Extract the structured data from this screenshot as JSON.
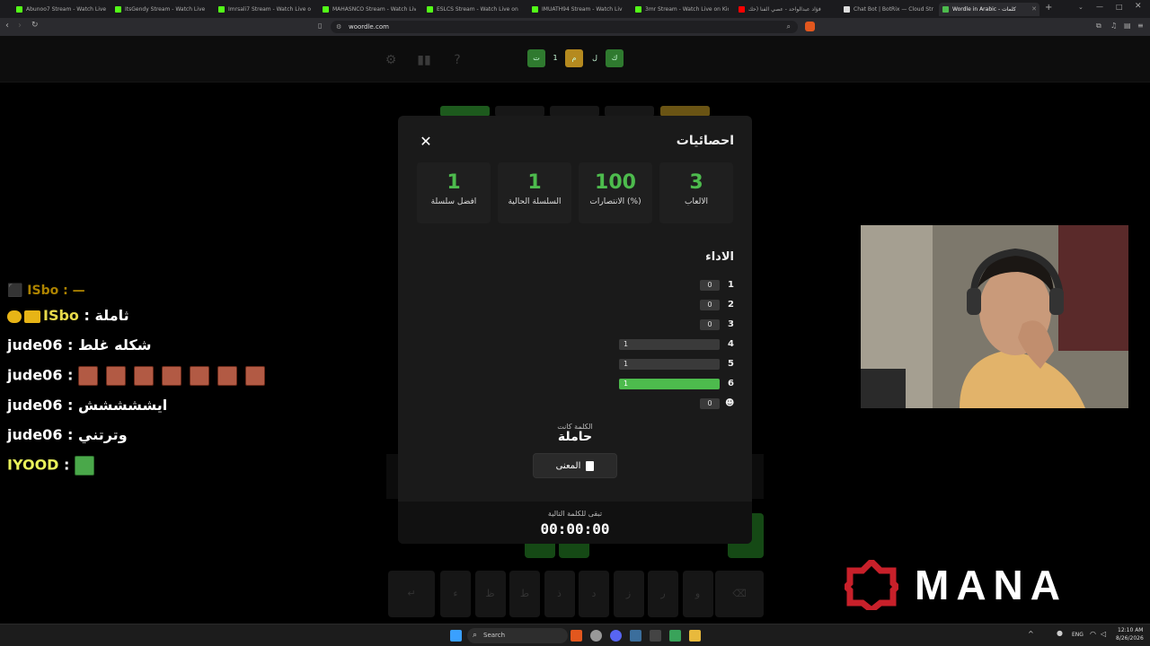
{
  "browser": {
    "tabs": [
      {
        "label": "Abunoo7 Stream - Watch Live",
        "favicon": "kick-icon"
      },
      {
        "label": "ItsGendy Stream - Watch Live",
        "favicon": "kick-icon"
      },
      {
        "label": "Imrsali7 Stream - Watch Live o",
        "favicon": "kick-icon"
      },
      {
        "label": "MAHASNCO Stream - Watch Live",
        "favicon": "kick-icon"
      },
      {
        "label": "ESLCS Stream - Watch Live on",
        "favicon": "kick-icon"
      },
      {
        "label": "IMUATH94 Stream - Watch Liv",
        "favicon": "kick-icon"
      },
      {
        "label": "3mr Stream - Watch Live on Kick",
        "favicon": "kick-icon"
      },
      {
        "label": "فؤاد عبدالواحد - عصي الفنا (حك",
        "favicon": "youtube-icon"
      },
      {
        "label": "Chat Bot | BotRix — Cloud Stream",
        "favicon": "botrix-icon"
      },
      {
        "label": "Wordle in Arabic - كلمات",
        "favicon": "woordle-icon",
        "active": true
      }
    ],
    "url": "woordle.com"
  },
  "game_header": {
    "tiles": [
      {
        "letter": "ت",
        "color": "#2f7a2f"
      },
      {
        "letter": "1",
        "color": "transparent"
      },
      {
        "letter": "م",
        "color": "#b58a1f"
      },
      {
        "letter": "ل",
        "color": "transparent"
      },
      {
        "letter": "ك",
        "color": "#2f7a2f"
      }
    ]
  },
  "chat": [
    {
      "user": "ISbo",
      "message": "ثاملة",
      "badges": true
    },
    {
      "user": "jude06",
      "message": "شكله غلط"
    },
    {
      "user": "jude06",
      "message": "",
      "emotes": 7
    },
    {
      "user": "jude06",
      "message": "ايششششش"
    },
    {
      "user": "jude06",
      "message": "وترتني"
    },
    {
      "user": "IYOOD",
      "message": "",
      "emotes": 1
    }
  ],
  "stats_modal": {
    "title": "احصائيات",
    "stats": [
      {
        "value": "3",
        "label": "الالعاب"
      },
      {
        "value": "100",
        "label": "الانتصارات (%)"
      },
      {
        "value": "1",
        "label": "السلسلة الحالية"
      },
      {
        "value": "1",
        "label": "افضل سلسلة"
      }
    ],
    "performance_title": "الاداء",
    "distribution": [
      {
        "row": "1",
        "count": 0,
        "count_label": "0",
        "fraction": 0.0
      },
      {
        "row": "2",
        "count": 0,
        "count_label": "0",
        "fraction": 0.0
      },
      {
        "row": "3",
        "count": 0,
        "count_label": "0",
        "fraction": 0.0
      },
      {
        "row": "4",
        "count": 1,
        "count_label": "1",
        "fraction": 1.0
      },
      {
        "row": "5",
        "count": 1,
        "count_label": "1",
        "fraction": 1.0
      },
      {
        "row": "6",
        "count": 1,
        "count_label": "1",
        "fraction": 1.0,
        "current": true
      },
      {
        "row": "skull",
        "count": 0,
        "count_label": "0",
        "fraction": 0.0
      }
    ],
    "answer_label": "الكلمة كانت",
    "answer_word": "حاملة",
    "meaning_button": "المعنى",
    "next_word_label": "تبقى للكلمة التالية",
    "countdown": "00:00:00"
  },
  "keyboard_row3": [
    "ء",
    "ظ",
    "ط",
    "ذ",
    "د",
    "ز",
    "ر",
    "و"
  ],
  "logo_text": "MANA",
  "taskbar": {
    "search_label": "Search",
    "lang": "ENG",
    "time": "12:10 AM",
    "date": "8/26/2026"
  },
  "colors": {
    "green": "#4dbb4d",
    "brand_red": "#c8202a"
  }
}
